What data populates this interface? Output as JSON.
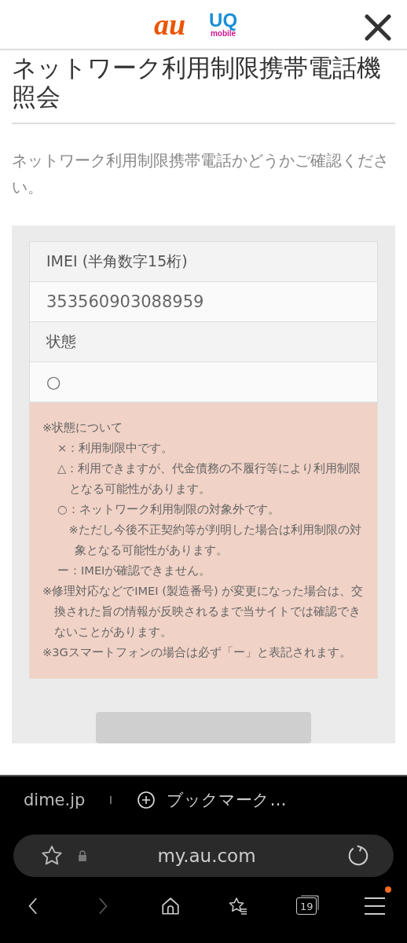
{
  "header": {
    "au_logo": "au",
    "uq_logo": {
      "text": "UQ",
      "subtext": "mobile"
    }
  },
  "title": "ネットワーク利用制限携帯電話機照会",
  "description": "ネットワーク利用制限携帯電話かどうかご確認ください。",
  "result_table": {
    "rows": [
      {
        "kind": "label",
        "text": "IMEI (半角数字15桁)"
      },
      {
        "kind": "value",
        "text": "353560903088959"
      },
      {
        "kind": "label",
        "text": "状態"
      },
      {
        "kind": "value",
        "text": "○"
      }
    ]
  },
  "notes": [
    {
      "kind": "heading",
      "text": "※状態について"
    },
    {
      "kind": "status",
      "text": "×：利用制限中です。"
    },
    {
      "kind": "status",
      "text": "△：利用できますが、代金債務の不履行等により利用制限となる可能性があります。"
    },
    {
      "kind": "status",
      "text": "○：ネットワーク利用制限の対象外です。"
    },
    {
      "kind": "sub",
      "text": "※ただし今後不正契約等が判明した場合は利用制限の対象となる可能性があります。"
    },
    {
      "kind": "status",
      "text": "ー：IMEIが確認できません。"
    },
    {
      "kind": "note",
      "text": "※修理対応などでIMEI (製造番号) が変更になった場合は、交換された旨の情報が反映されるまで当サイトでは確認できないことがあります。"
    },
    {
      "kind": "note",
      "text": "※3Gスマートフォンの場合は必ず「ー」と表記されます。"
    }
  ],
  "browser": {
    "bookmark_site": "dime.jp",
    "bookmark_add": "ブックマーク…",
    "url": "my.au.com",
    "tab_count": "19",
    "forward_disabled": true,
    "menu_badge": true
  }
}
